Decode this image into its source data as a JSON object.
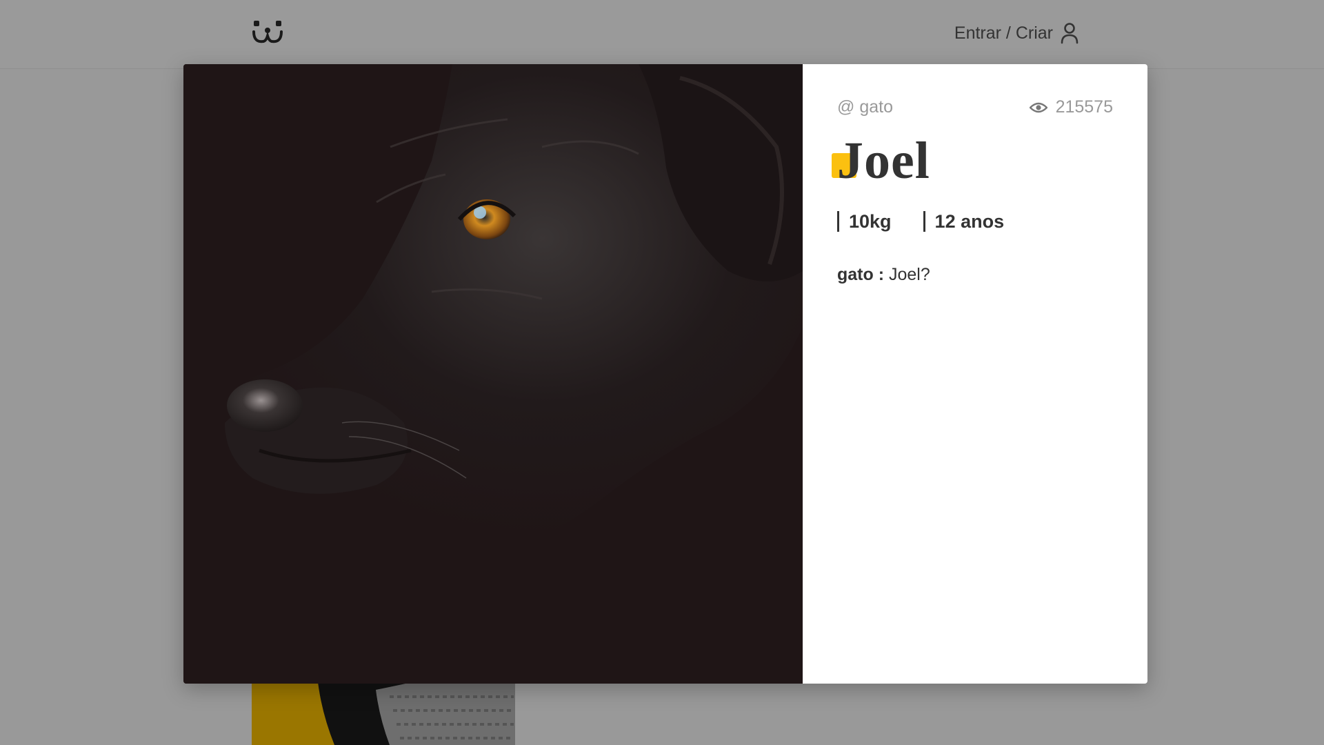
{
  "header": {
    "logo_icon": "dog-face-icon",
    "login_label": "Entrar / Criar",
    "login_icon": "user-icon"
  },
  "photo_modal": {
    "author": "@ gato",
    "views_icon": "eye-icon",
    "views": "215575",
    "title": "Joel",
    "accent_color": "#fbc010",
    "attributes": [
      {
        "label": "10kg"
      },
      {
        "label": "12 anos"
      }
    ],
    "comments": [
      {
        "author": "gato :",
        "text": " Joel?"
      }
    ]
  },
  "background": {
    "overlay_color": "#999999",
    "feed_photo_color": "#9a7600"
  }
}
